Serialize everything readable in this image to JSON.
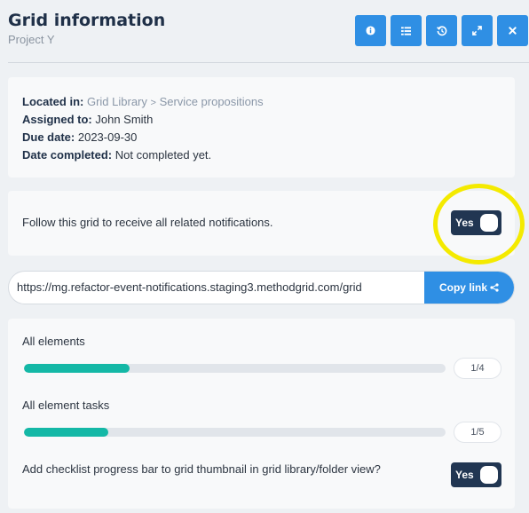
{
  "header": {
    "title": "Grid information",
    "subtitle": "Project Y",
    "toolbar": [
      {
        "name": "info-icon"
      },
      {
        "name": "list-icon"
      },
      {
        "name": "history-icon"
      },
      {
        "name": "expand-icon"
      },
      {
        "name": "close-icon"
      }
    ]
  },
  "info": {
    "located_label": "Located in:",
    "located_path": [
      "Grid Library",
      "Service propositions"
    ],
    "path_separator": ">",
    "assigned_label": "Assigned to:",
    "assigned_value": "John Smith",
    "due_label": "Due date:",
    "due_value": "2023-09-30",
    "completed_label": "Date completed:",
    "completed_value": "Not completed yet."
  },
  "follow": {
    "text": "Follow this grid to receive all related notifications.",
    "toggle_label": "Yes",
    "toggle_on": true
  },
  "share": {
    "url": "https://mg.refactor-event-notifications.staging3.methodgrid.com/grid",
    "copy_label": "Copy link",
    "copy_icon": "share-icon"
  },
  "progress": {
    "elements": {
      "label": "All elements",
      "done": 1,
      "total": 4,
      "count_text": "1/4"
    },
    "tasks": {
      "label": "All element tasks",
      "done": 1,
      "total": 5,
      "count_text": "1/5"
    },
    "checklist": {
      "text": "Add checklist progress bar to grid thumbnail in grid library/folder view?",
      "toggle_label": "Yes",
      "toggle_on": true
    }
  },
  "colors": {
    "accent": "#2f8fe4",
    "toggle_bg": "#213652",
    "progress_fill": "#14b8a6",
    "highlight_ring": "#f4ea00"
  }
}
